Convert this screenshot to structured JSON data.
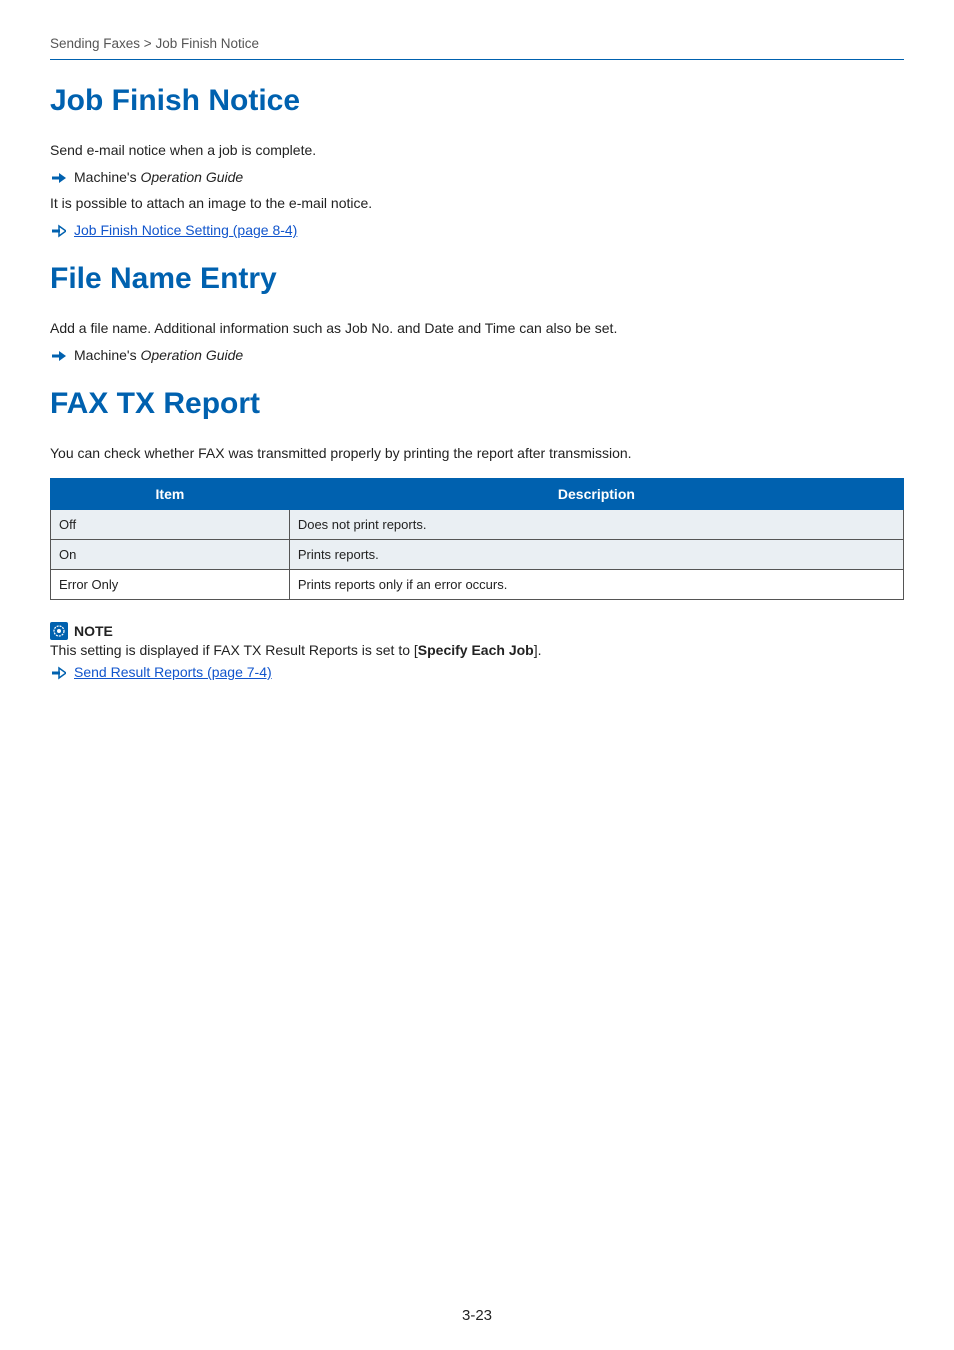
{
  "breadcrumb": "Sending Faxes > Job Finish Notice",
  "sections": {
    "jobFinish": {
      "heading": "Job Finish Notice",
      "intro": "Send e-mail notice when a job is complete.",
      "ref1_prefix": "Machine's ",
      "ref1_italic": "Operation Guide",
      "body2": "It is possible to attach an image to the e-mail notice.",
      "link": "Job Finish Notice Setting (page 8-4)"
    },
    "fileName": {
      "heading": "File Name Entry",
      "intro": "Add a file name. Additional information such as Job No. and Date and Time can also be set.",
      "ref1_prefix": "Machine's ",
      "ref1_italic": "Operation Guide"
    },
    "faxTx": {
      "heading": "FAX TX Report",
      "intro": "You can check whether FAX was transmitted properly by printing the report after transmission.",
      "table": {
        "headers": {
          "col1": "Item",
          "col2": "Description"
        },
        "rows": [
          {
            "item": "Off",
            "desc": "Does not print reports."
          },
          {
            "item": "On",
            "desc": "Prints reports."
          },
          {
            "item": "Error Only",
            "desc": "Prints reports only if an error occurs."
          }
        ]
      },
      "note": {
        "label": "NOTE",
        "text_pre": "This setting is displayed if FAX TX Result Reports is set to [",
        "text_bold": "Specify Each Job",
        "text_post": "].",
        "link": "Send Result Reports (page 7-4)"
      }
    }
  },
  "pageNumber": "3-23"
}
